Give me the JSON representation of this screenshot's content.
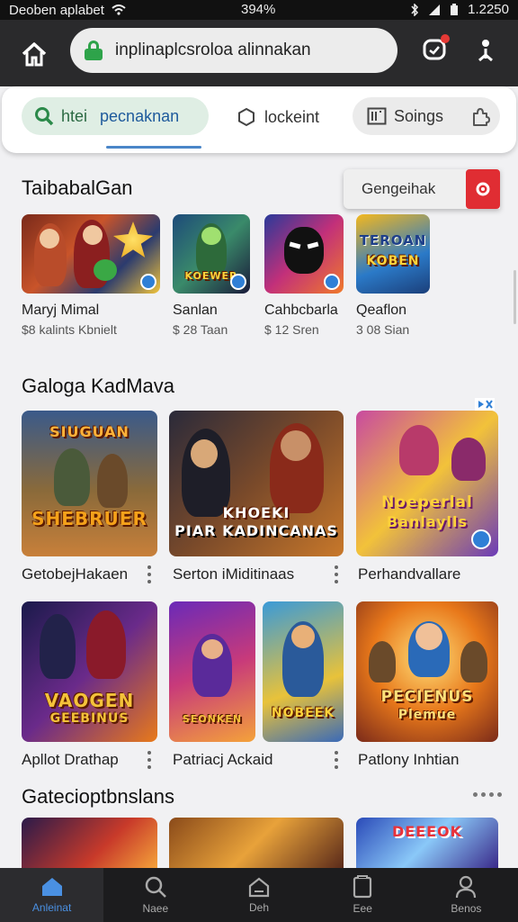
{
  "status_bar": {
    "carrier": "Deoben aplabet",
    "battery": "394%",
    "time": "1.2250"
  },
  "browser": {
    "url": "inplinaplcsroloa alinnakan"
  },
  "tabs": [
    {
      "label": "htei",
      "label2": "pecnaknan"
    },
    {
      "label": "lockeint"
    },
    {
      "label": "Soings"
    }
  ],
  "search_pill": {
    "label": "Gengeihak"
  },
  "section1": {
    "title": "TaibabalGan",
    "apps": [
      {
        "name": "Maryj Mimal",
        "meta": "$8 kalints Kbnielt"
      },
      {
        "name": "Sanlan",
        "meta": "$ 28 Taan"
      },
      {
        "name": "Cahbcbarla",
        "meta": "$ 12 Sren"
      },
      {
        "name": "Qeaflon",
        "meta": "3 08 Sian"
      }
    ],
    "art_labels": [
      "TEROAN",
      "KOBEN",
      "KOEWER"
    ]
  },
  "section2": {
    "title": "Galoga KadMava",
    "cards_row1": [
      {
        "title": "GetobejHakaen",
        "art": "SIUGUAN",
        "art2": "SHEBRUER"
      },
      {
        "title": "Serton iMiditinaas",
        "art": "KHOEKI",
        "art2": "PIAR KADINCANAS"
      },
      {
        "title": "Perhandvallare",
        "art": "Noeperlal",
        "art2": "Banlaylls"
      }
    ],
    "cards_row2": [
      {
        "title": "Apllot Drathap",
        "art": "VAOGEN",
        "art2": "GEEBINUS"
      },
      {
        "title": "Patriacj Ackaid",
        "art": "SEONKEN",
        "art2": "NOBEEK"
      },
      {
        "title": "Patlony Inhtian",
        "art": "PECIENUS",
        "art2": "Plemue"
      }
    ]
  },
  "section3": {
    "title": "Gatecioptbnslans",
    "art": "DEEEOK"
  },
  "nav": [
    {
      "label": "Anleinat"
    },
    {
      "label": "Naee"
    },
    {
      "label": "Deh"
    },
    {
      "label": "Eee"
    },
    {
      "label": "Benos"
    }
  ],
  "colors": {
    "accent": "#4a90e2",
    "lock_green": "#2ea34a",
    "search_red": "#e02d33"
  }
}
